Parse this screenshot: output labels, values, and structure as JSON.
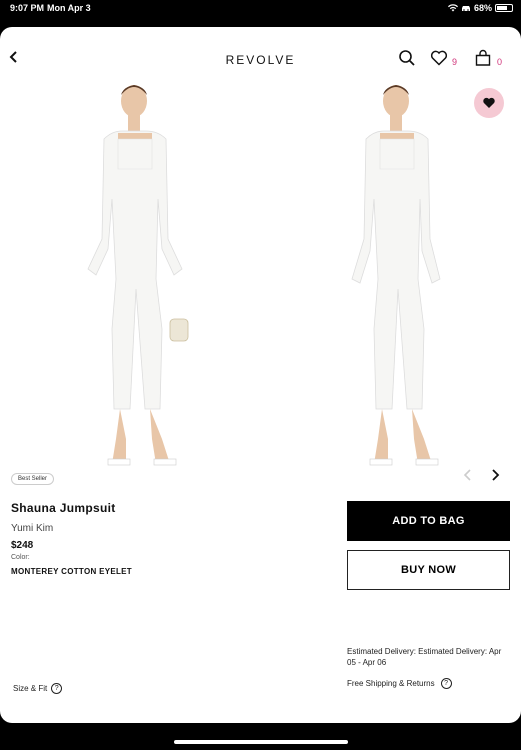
{
  "status_bar": {
    "time": "9:07 PM",
    "date": "Mon Apr 3",
    "battery": "68%",
    "battery_level": 0.68
  },
  "header": {
    "logo": "REVOLVE",
    "wishlist_count": "9",
    "bag_count": "0"
  },
  "gallery": {
    "badge": "Best Seller"
  },
  "product": {
    "name": "Shauna Jumpsuit",
    "brand": "Yumi Kim",
    "price": "$248",
    "color_label": "Color:",
    "color_value": "MONTEREY COTTON EYELET"
  },
  "actions": {
    "add_to_bag": "ADD TO BAG",
    "buy_now": "BUY NOW"
  },
  "delivery": {
    "estimate": "Estimated Delivery: Estimated Delivery: Apr 05 - Apr 06"
  },
  "shipping": {
    "label": "Free Shipping & Returns"
  },
  "size_fit": {
    "label": "Size & Fit"
  },
  "colors": {
    "accent_pink": "#d0347a",
    "fav_bg": "#f5c9d3"
  },
  "icons": [
    "back-arrow-icon",
    "search-icon",
    "heart-icon",
    "bag-icon",
    "heart-filled-icon",
    "chevron-left-icon",
    "chevron-right-icon",
    "help-icon",
    "wifi-icon",
    "car-icon",
    "battery-icon"
  ]
}
